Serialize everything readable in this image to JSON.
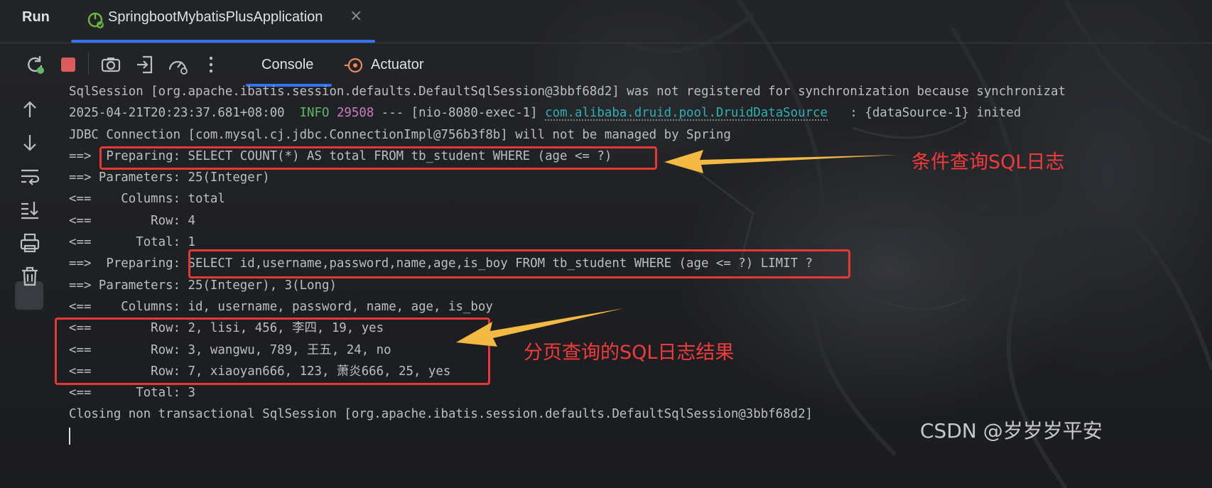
{
  "header": {
    "run_label": "Run",
    "tab_app_name": "SpringbootMybatisPlusApplication",
    "tab_close": "×"
  },
  "toolbar": {
    "icons": [
      "rerun-icon",
      "stop-icon",
      "camera-icon",
      "exit-icon",
      "speedometer-icon",
      "more-icon"
    ],
    "tabs": {
      "console": "Console",
      "actuator": "Actuator"
    }
  },
  "gutter": {
    "icons": [
      "arrow-up-icon",
      "arrow-down-icon",
      "soft-wrap-icon",
      "scroll-to-end-icon",
      "print-icon",
      "trash-icon"
    ]
  },
  "console": {
    "l1": "SqlSession [org.apache.ibatis.session.defaults.DefaultSqlSession@3bbf68d2] was not registered for synchronization because synchronizat",
    "l2_ts": "2025-04-21T20:23:37.681+08:00  ",
    "l2_level": "INFO",
    "l2_pid": "29508",
    "l2_thread": " --- [nio-8080-exec-1] ",
    "l2_logger": "com.alibaba.druid.pool.DruidDataSource",
    "l2_msg": "   : {dataSource-1} inited",
    "l3": "JDBC Connection [com.mysql.cj.jdbc.ConnectionImpl@756b3f8b] will not be managed by Spring",
    "l4": "==>  Preparing: SELECT COUNT(*) AS total FROM tb_student WHERE (age <= ?)",
    "l5": "==> Parameters: 25(Integer)",
    "l6": "<==    Columns: total",
    "l7": "<==        Row: 4",
    "l8": "<==      Total: 1",
    "l9": "==>  Preparing: SELECT id,username,password,name,age,is_boy FROM tb_student WHERE (age <= ?) LIMIT ?",
    "l10": "==> Parameters: 25(Integer), 3(Long)",
    "l11": "<==    Columns: id, username, password, name, age, is_boy",
    "l12": "<==        Row: 2, lisi, 456, 李四, 19, yes",
    "l13": "<==        Row: 3, wangwu, 789, 王五, 24, no",
    "l14": "<==        Row: 7, xiaoyan666, 123, 萧炎666, 25, yes",
    "l15": "<==      Total: 3",
    "l16": "Closing non transactional SqlSession [org.apache.ibatis.session.defaults.DefaultSqlSession@3bbf68d2]"
  },
  "annotations": {
    "top": "条件查询SQL日志",
    "bottom": "分页查询的SQL日志结果",
    "color": "#f23b3b",
    "arrow_color": "#f4b942"
  },
  "watermark": "CSDN @岁岁岁平安"
}
